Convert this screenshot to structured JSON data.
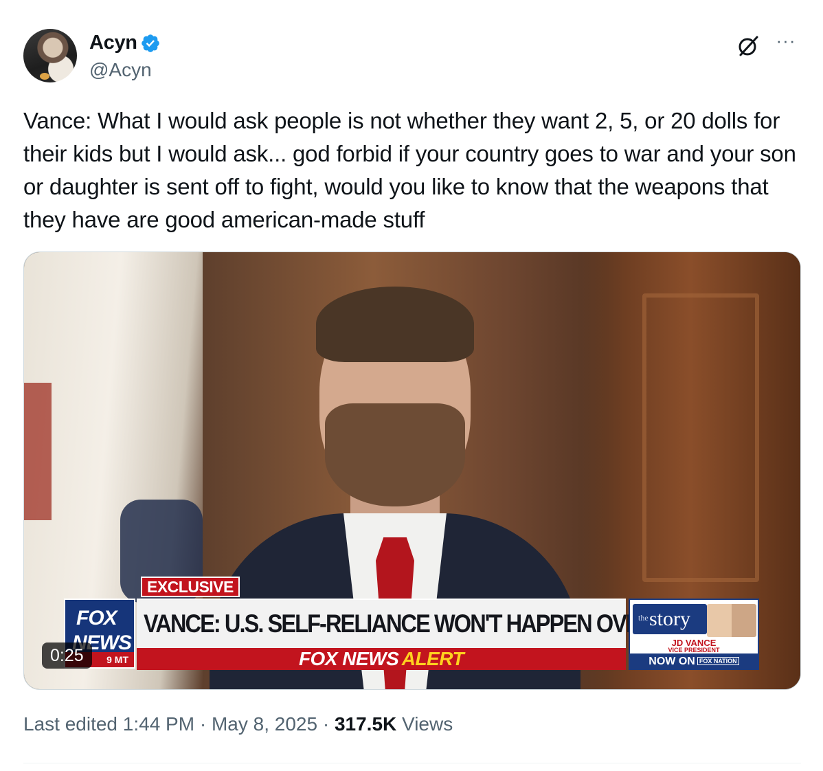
{
  "author": {
    "display_name": "Acyn",
    "handle": "@Acyn",
    "verified_icon": "verified-badge-icon",
    "avatar_icon": "avatar"
  },
  "actions": {
    "grok_icon": "grok-icon",
    "more_icon": "more-options-icon"
  },
  "tweet": {
    "text": "Vance: What I would ask people is not whether they want 2, 5, or 20 dolls for their kids but I would ask... god forbid if your country goes to war and your son or daughter is sent off to fight, would you like to know that the weapons that they have are good american-made stuff"
  },
  "video": {
    "duration": "0:25",
    "exclusive_label": "EXCLUSIVE",
    "headline": "VANCE: U.S. SELF-RELIANCE WON'T HAPPEN OVERNIGHT",
    "channel_logo_line1": "FOX",
    "channel_logo_line2": "NEWS",
    "channel_time": "9 MT",
    "alert_brand": "FOX NEWS",
    "alert_word": "ALERT",
    "show_small": "the",
    "show_name": "story",
    "guest_name": "JD VANCE",
    "guest_title": "VICE PRESIDENT",
    "now_on": "NOW ON",
    "now_on_brand": "FOX NATION"
  },
  "meta": {
    "edited_label": "Last edited",
    "time": "1:44 PM",
    "separator": "·",
    "date": "May 8, 2025",
    "views_count": "317.5K",
    "views_label": "Views"
  },
  "colors": {
    "text_primary": "#0f1419",
    "text_secondary": "#536471",
    "verified_blue": "#1d9bf0",
    "fox_red": "#c2141e",
    "fox_blue": "#16357a"
  }
}
